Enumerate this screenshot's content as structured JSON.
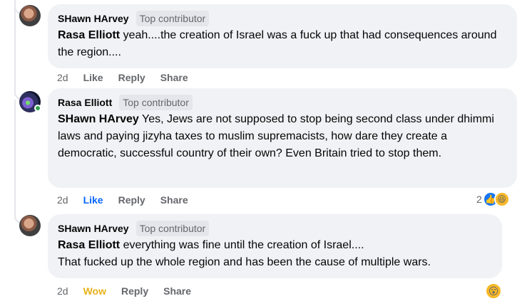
{
  "comments": [
    {
      "author": "SHawn HArvey",
      "badge": "Top contributor",
      "mention": "Rasa Elliott",
      "text": " yeah....the creation of Israel was a fuck up that had consequences around the region....",
      "time": "2d",
      "like": "Like",
      "reply": "Reply",
      "share": "Share"
    },
    {
      "author": "Rasa Elliott",
      "badge": "Top contributor",
      "mention": "SHawn HArvey",
      "text": " Yes, Jews are not supposed to stop being second class under dhimmi laws and paying jizyha taxes to muslim supremacists, how dare they create a democratic, successful country of their own? Even Britain tried to stop them.",
      "time": "2d",
      "like": "Like",
      "reply": "Reply",
      "share": "Share",
      "reaction_count": "2",
      "reactions": [
        "like-icon",
        "haha-icon"
      ],
      "like_color": "#0866ff"
    },
    {
      "author": "SHawn HArvey",
      "badge": "Top contributor",
      "mention": "Rasa Elliott",
      "text_line1": " everything was fine until the creation of Israel....",
      "text_line2": "That fucked up the whole region and has been the cause of multiple wars.",
      "time": "2d",
      "like": "Wow",
      "reply": "Reply",
      "share": "Share",
      "reactions": [
        "wow-icon"
      ],
      "like_color": "#e8b21b"
    }
  ],
  "colors": {
    "bubble": "#f0f2f5",
    "meta": "#65676b",
    "accent": "#0866ff"
  }
}
